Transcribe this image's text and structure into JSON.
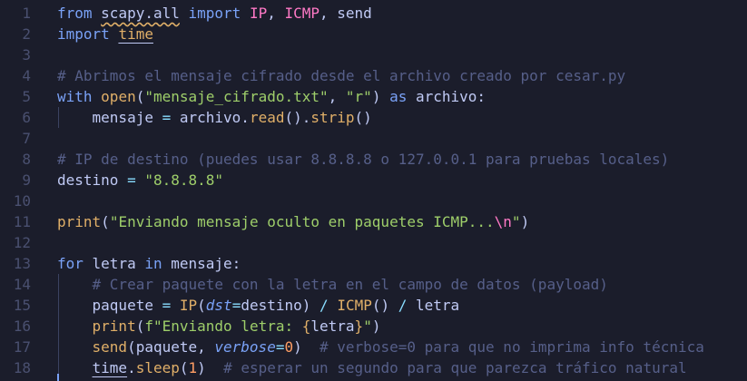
{
  "lines": [
    {
      "num": "1",
      "tokens": [
        {
          "t": "from ",
          "c": "kw"
        },
        {
          "t": "scapy.all",
          "c": "plain squig"
        },
        {
          "t": " import ",
          "c": "kw"
        },
        {
          "t": "IP",
          "c": "cls"
        },
        {
          "t": ", ",
          "c": "plain"
        },
        {
          "t": "ICMP",
          "c": "cls"
        },
        {
          "t": ", send",
          "c": "plain"
        }
      ]
    },
    {
      "num": "2",
      "tokens": [
        {
          "t": "import ",
          "c": "kw"
        },
        {
          "t": "time",
          "c": "mod under"
        }
      ]
    },
    {
      "num": "3",
      "tokens": []
    },
    {
      "num": "4",
      "tokens": [
        {
          "t": "# Abrimos el mensaje cifrado desde el archivo creado por cesar.py",
          "c": "cmt"
        }
      ]
    },
    {
      "num": "5",
      "tokens": [
        {
          "t": "with ",
          "c": "kw"
        },
        {
          "t": "open",
          "c": "fn"
        },
        {
          "t": "(",
          "c": "plain"
        },
        {
          "t": "\"mensaje_cifrado.txt\"",
          "c": "str"
        },
        {
          "t": ", ",
          "c": "plain"
        },
        {
          "t": "\"r\"",
          "c": "str"
        },
        {
          "t": ") ",
          "c": "plain"
        },
        {
          "t": "as",
          "c": "kw"
        },
        {
          "t": " archivo:",
          "c": "plain"
        }
      ]
    },
    {
      "num": "6",
      "indent": true,
      "tokens": [
        {
          "t": "    mensaje ",
          "c": "plain"
        },
        {
          "t": "=",
          "c": "op"
        },
        {
          "t": " archivo.",
          "c": "plain"
        },
        {
          "t": "read",
          "c": "fn"
        },
        {
          "t": "().",
          "c": "plain"
        },
        {
          "t": "strip",
          "c": "fn"
        },
        {
          "t": "()",
          "c": "plain"
        }
      ]
    },
    {
      "num": "7",
      "tokens": []
    },
    {
      "num": "8",
      "tokens": [
        {
          "t": "# IP de destino (puedes usar 8.8.8.8 o 127.0.0.1 para pruebas locales)",
          "c": "cmt"
        }
      ]
    },
    {
      "num": "9",
      "tokens": [
        {
          "t": "destino ",
          "c": "plain"
        },
        {
          "t": "=",
          "c": "op"
        },
        {
          "t": " ",
          "c": "plain"
        },
        {
          "t": "\"8.8.8.8\"",
          "c": "str"
        }
      ]
    },
    {
      "num": "10",
      "tokens": []
    },
    {
      "num": "11",
      "tokens": [
        {
          "t": "print",
          "c": "fn"
        },
        {
          "t": "(",
          "c": "plain"
        },
        {
          "t": "\"Enviando mensaje oculto en paquetes ICMP...",
          "c": "str"
        },
        {
          "t": "\\n",
          "c": "esc"
        },
        {
          "t": "\"",
          "c": "str"
        },
        {
          "t": ")",
          "c": "plain"
        }
      ]
    },
    {
      "num": "12",
      "tokens": []
    },
    {
      "num": "13",
      "tokens": [
        {
          "t": "for",
          "c": "kw"
        },
        {
          "t": " letra ",
          "c": "plain"
        },
        {
          "t": "in",
          "c": "kw"
        },
        {
          "t": " mensaje:",
          "c": "plain"
        }
      ]
    },
    {
      "num": "14",
      "indent": true,
      "tokens": [
        {
          "t": "    ",
          "c": "plain"
        },
        {
          "t": "# Crear paquete con la letra en el campo de datos (payload)",
          "c": "cmt"
        }
      ]
    },
    {
      "num": "15",
      "indent": true,
      "tokens": [
        {
          "t": "    paquete ",
          "c": "plain"
        },
        {
          "t": "=",
          "c": "op"
        },
        {
          "t": " ",
          "c": "plain"
        },
        {
          "t": "IP",
          "c": "fn"
        },
        {
          "t": "(",
          "c": "plain"
        },
        {
          "t": "dst",
          "c": "param"
        },
        {
          "t": "=",
          "c": "op"
        },
        {
          "t": "destino) ",
          "c": "plain"
        },
        {
          "t": "/",
          "c": "op"
        },
        {
          "t": " ",
          "c": "plain"
        },
        {
          "t": "ICMP",
          "c": "fn"
        },
        {
          "t": "() ",
          "c": "plain"
        },
        {
          "t": "/",
          "c": "op"
        },
        {
          "t": " letra",
          "c": "plain"
        }
      ]
    },
    {
      "num": "16",
      "indent": true,
      "tokens": [
        {
          "t": "    ",
          "c": "plain"
        },
        {
          "t": "print",
          "c": "fn"
        },
        {
          "t": "(",
          "c": "plain"
        },
        {
          "t": "f\"Enviando letra: ",
          "c": "str"
        },
        {
          "t": "{",
          "c": "fn"
        },
        {
          "t": "letra",
          "c": "plain"
        },
        {
          "t": "}",
          "c": "fn"
        },
        {
          "t": "\"",
          "c": "str"
        },
        {
          "t": ")",
          "c": "plain"
        }
      ]
    },
    {
      "num": "17",
      "indent": true,
      "tokens": [
        {
          "t": "    ",
          "c": "plain"
        },
        {
          "t": "send",
          "c": "fn"
        },
        {
          "t": "(paquete, ",
          "c": "plain"
        },
        {
          "t": "verbose",
          "c": "param"
        },
        {
          "t": "=",
          "c": "op"
        },
        {
          "t": "0",
          "c": "num"
        },
        {
          "t": ")  ",
          "c": "plain"
        },
        {
          "t": "# verbose=0 para que no imprima info técnica",
          "c": "cmt"
        }
      ]
    },
    {
      "num": "18",
      "indent": true,
      "tokens": [
        {
          "t": "    ",
          "c": "plain"
        },
        {
          "t": "time",
          "c": "plain under"
        },
        {
          "t": ".",
          "c": "plain"
        },
        {
          "t": "sleep",
          "c": "fn"
        },
        {
          "t": "(",
          "c": "plain"
        },
        {
          "t": "1",
          "c": "num"
        },
        {
          "t": ")  ",
          "c": "plain"
        },
        {
          "t": "# esperar un segundo para que parezca tráfico natural",
          "c": "cmt"
        }
      ]
    }
  ]
}
